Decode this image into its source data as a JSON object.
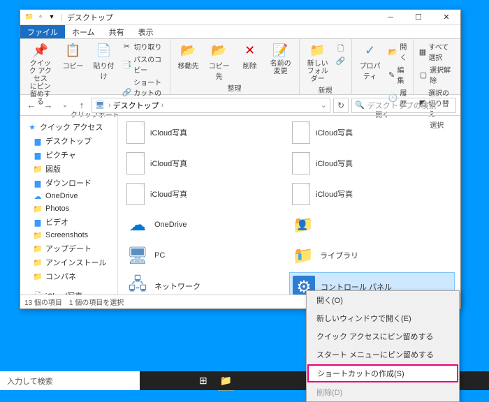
{
  "titlebar": {
    "title": "デスクトップ"
  },
  "tabs": {
    "file": "ファイル",
    "home": "ホーム",
    "share": "共有",
    "view": "表示"
  },
  "ribbon": {
    "clipboard": {
      "label": "クリップボード",
      "pin_quick": "クイック アクセス\nにピン留めする",
      "copy": "コピー",
      "paste": "貼り付け",
      "cut": "切り取り",
      "copy_path": "パスのコピー",
      "paste_shortcut": "ショートカットの貼り付け"
    },
    "organize": {
      "label": "整理",
      "move_to": "移動先",
      "copy_to": "コピー先",
      "delete": "削除",
      "rename": "名前の\n変更"
    },
    "new": {
      "label": "新規",
      "new_folder": "新しい\nフォルダー"
    },
    "open": {
      "label": "開く",
      "properties": "プロパティ",
      "open": "開く",
      "edit": "編集",
      "history": "履歴"
    },
    "select": {
      "label": "選択",
      "select_all": "すべて選択",
      "select_none": "選択解除",
      "invert": "選択の切り替え"
    }
  },
  "navbar": {
    "breadcrumb": "デスクトップ",
    "search_placeholder": "デスクトップの検索"
  },
  "sidebar": {
    "items": [
      {
        "label": "クイック アクセス",
        "icon": "star"
      },
      {
        "label": "デスクトップ",
        "icon": "bluefolder"
      },
      {
        "label": "ピクチャ",
        "icon": "bluefolder"
      },
      {
        "label": "図版",
        "icon": "folder"
      },
      {
        "label": "ダウンロード",
        "icon": "bluefolder"
      },
      {
        "label": "OneDrive",
        "icon": "onedrive"
      },
      {
        "label": "Photos",
        "icon": "folder"
      },
      {
        "label": "ビデオ",
        "icon": "bluefolder"
      },
      {
        "label": "Screenshots",
        "icon": "folder"
      },
      {
        "label": "アップデート",
        "icon": "folder"
      },
      {
        "label": "アンインストール",
        "icon": "folder"
      },
      {
        "label": "コンパネ",
        "icon": "folder"
      },
      {
        "label": "",
        "icon": "spacer"
      },
      {
        "label": "iCloud写真",
        "icon": "doc"
      }
    ]
  },
  "files": {
    "left": [
      {
        "label": "iCloud写真",
        "icon": "doc"
      },
      {
        "label": "iCloud写真",
        "icon": "doc"
      },
      {
        "label": "iCloud写真",
        "icon": "doc"
      },
      {
        "label": "OneDrive",
        "icon": "onedrive"
      },
      {
        "label": "PC",
        "icon": "pc"
      },
      {
        "label": "ネットワーク",
        "icon": "network"
      }
    ],
    "right": [
      {
        "label": "iCloud写真",
        "icon": "doc"
      },
      {
        "label": "iCloud写真",
        "icon": "doc"
      },
      {
        "label": "iCloud写真",
        "icon": "doc"
      },
      {
        "label": "",
        "icon": "user"
      },
      {
        "label": "ライブラリ",
        "icon": "library"
      },
      {
        "label": "コントロール パネル",
        "icon": "controlpanel",
        "selected": true
      }
    ]
  },
  "status": {
    "count": "13 個の項目",
    "selected": "1 個の項目を選択"
  },
  "context": {
    "open": "開く(O)",
    "new_window": "新しいウィンドウで開く(E)",
    "pin_quick": "クイック アクセスにピン留めする",
    "pin_start": "スタート メニューにピン留めする",
    "create_shortcut": "ショートカットの作成(S)",
    "delete": "削除(D)"
  },
  "taskbar": {
    "search": "入力して検索"
  }
}
